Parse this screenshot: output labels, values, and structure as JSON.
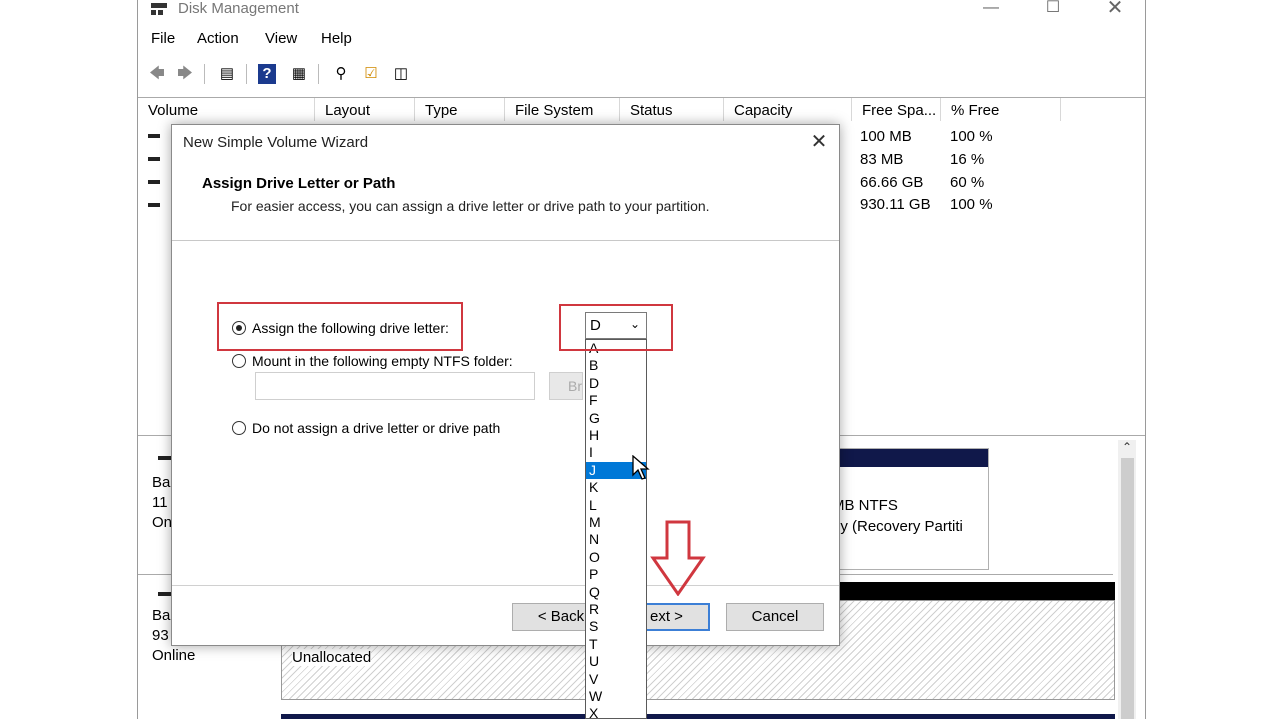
{
  "window": {
    "title": "Disk Management"
  },
  "menu": [
    "File",
    "Action",
    "View",
    "Help"
  ],
  "columns": [
    "Volume",
    "Layout",
    "Type",
    "File System",
    "Status",
    "Capacity",
    "Free Spa...",
    "% Free"
  ],
  "volume_rows": [
    {
      "free": "100 MB",
      "pct": "100 %"
    },
    {
      "free": "83 MB",
      "pct": "16 %"
    },
    {
      "free": "66.66 GB",
      "pct": "60 %"
    },
    {
      "free": "930.11 GB",
      "pct": "100 %"
    }
  ],
  "disk_map": {
    "disk0_lines": [
      "Ba",
      "11",
      "On"
    ],
    "disk1_lines": [
      "Ba",
      "93",
      "Online"
    ],
    "partition_fs": "MB NTFS",
    "partition_desc": "hy (Recovery Partiti",
    "unallocated": "Unallocated"
  },
  "dialog": {
    "title": "New Simple Volume Wizard",
    "heading": "Assign Drive Letter or Path",
    "subheading": "For easier access, you can assign a drive letter or drive path to your partition.",
    "option_assign": "Assign the following drive letter:",
    "option_mount": "Mount in the following empty NTFS folder:",
    "option_none": "Do not assign a drive letter or drive path",
    "browse_label": "Br",
    "back_label": "< Back",
    "next_label": "ext >",
    "cancel_label": "Cancel",
    "selected_letter": "D"
  },
  "drive_letters": [
    "A",
    "B",
    "D",
    "F",
    "G",
    "H",
    "I",
    "J",
    "K",
    "L",
    "M",
    "N",
    "O",
    "P",
    "Q",
    "R",
    "S",
    "T",
    "U",
    "V",
    "W",
    "X"
  ],
  "highlighted_letter": "J",
  "icons": [
    "back-arrow-icon",
    "forward-arrow-icon",
    "properties-icon",
    "help-icon",
    "view-icon",
    "key-icon",
    "check-icon",
    "console-icon",
    "chevron-down-icon",
    "close-icon",
    "mouse-cursor-icon",
    "down-arrow-callout-icon"
  ],
  "colors": {
    "highlight": "#0078d7",
    "callout": "#d0373f"
  }
}
